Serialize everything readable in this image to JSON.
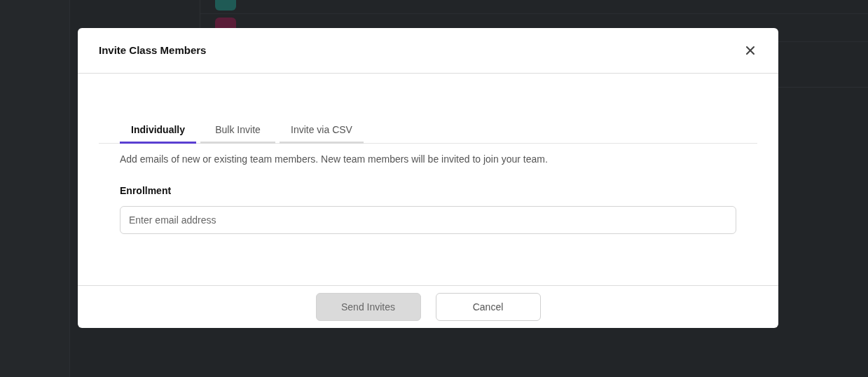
{
  "dialog": {
    "title": "Invite Class Members",
    "tabs": [
      {
        "label": "Individually",
        "selected": true
      },
      {
        "label": "Bulk Invite",
        "selected": false
      },
      {
        "label": "Invite via CSV",
        "selected": false
      }
    ],
    "description": "Add emails of new or existing team members. New team members will be invited to join your team.",
    "field": {
      "label": "Enrollment",
      "placeholder": "Enter email address"
    },
    "buttons": [
      {
        "label": "Send Invites",
        "kind": "primary",
        "disabled": true
      },
      {
        "label": "Cancel",
        "kind": "secondary",
        "disabled": false
      }
    ]
  },
  "background": {
    "avatars": [
      {
        "color": "#1f5a55"
      },
      {
        "color": "#5a1d38"
      }
    ]
  }
}
